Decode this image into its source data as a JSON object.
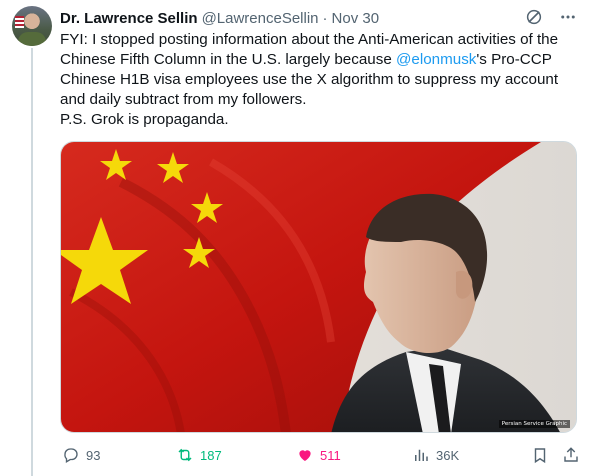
{
  "author": {
    "name": "Dr. Lawrence Sellin",
    "handle": "@LawrenceSellin",
    "separator": "·",
    "date": "Nov 30"
  },
  "tweet": {
    "line1": "FYI: I stopped posting information about the Anti-American activities of the Chinese Fifth Column in the U.S. largely because ",
    "mention": "@elonmusk",
    "line1_end": "'s Pro-CCP Chinese H1B visa employees use the X algorithm to suppress my account and daily subtract from my followers.",
    "line2": "P.S. Grok is propaganda."
  },
  "media": {
    "watermark": "Persian Service Graphic"
  },
  "actions": {
    "replies": "93",
    "reposts": "187",
    "likes": "511",
    "views": "36K"
  },
  "colors": {
    "accent": "#1d9bf0",
    "repost": "#00ba7c",
    "like": "#f91880",
    "muted": "#536471"
  },
  "icons": {
    "header": [
      "grok-icon",
      "more-icon"
    ],
    "actions": [
      "reply-icon",
      "repost-icon",
      "heart-icon",
      "views-icon",
      "bookmark-icon",
      "share-icon"
    ]
  }
}
